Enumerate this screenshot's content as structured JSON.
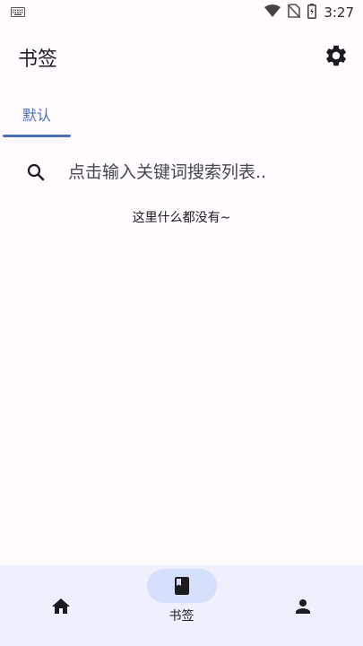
{
  "status_bar": {
    "time": "3:27",
    "icons": [
      "keyboard-icon",
      "wifi-icon",
      "no-sim-icon",
      "battery-charging-icon"
    ]
  },
  "header": {
    "title": "书签",
    "settings_icon": "gear-icon"
  },
  "tabs": [
    {
      "label": "默认",
      "selected": true
    }
  ],
  "search": {
    "placeholder": "点击输入关键词搜索列表..",
    "value": "",
    "icon": "search-icon"
  },
  "empty_state": {
    "message": "这里什么都没有~"
  },
  "bottom_nav": {
    "items": [
      {
        "label": "",
        "icon": "home-icon",
        "selected": false
      },
      {
        "label": "书签",
        "icon": "book-icon",
        "selected": true
      },
      {
        "label": "",
        "icon": "person-icon",
        "selected": false
      }
    ]
  },
  "colors": {
    "accent": "#4a6fb5",
    "background": "#fffbfe",
    "nav_background": "#eef0fb",
    "nav_pill": "#d6e0fa"
  }
}
